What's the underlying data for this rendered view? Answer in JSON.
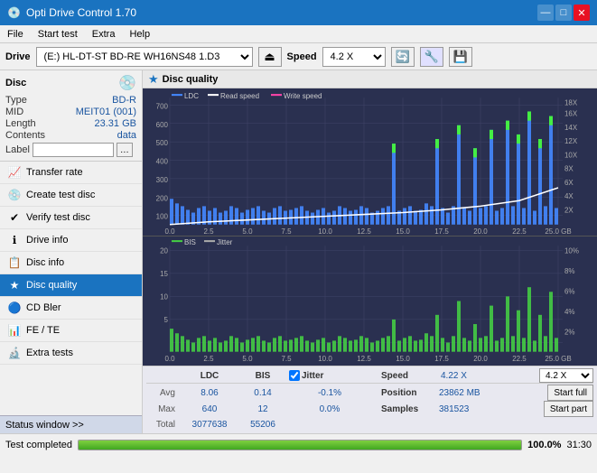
{
  "titleBar": {
    "title": "Opti Drive Control 1.70",
    "minBtn": "—",
    "maxBtn": "□",
    "closeBtn": "✕"
  },
  "menuBar": {
    "items": [
      "File",
      "Start test",
      "Extra",
      "Help"
    ]
  },
  "driveToolbar": {
    "driveLabel": "Drive",
    "driveValue": "(E:)  HL-DT-ST BD-RE  WH16NS48 1.D3",
    "speedLabel": "Speed",
    "speedValue": "4.2 X"
  },
  "sidebar": {
    "discSection": {
      "title": "Disc",
      "fields": [
        {
          "key": "Type",
          "value": "BD-R",
          "colored": true
        },
        {
          "key": "MID",
          "value": "MEIT01 (001)",
          "colored": true
        },
        {
          "key": "Length",
          "value": "23.31 GB",
          "colored": true
        },
        {
          "key": "Contents",
          "value": "data",
          "colored": true
        },
        {
          "key": "Label",
          "value": "",
          "isInput": true
        }
      ]
    },
    "navItems": [
      {
        "id": "transfer-rate",
        "label": "Transfer rate",
        "icon": "📈"
      },
      {
        "id": "create-test-disc",
        "label": "Create test disc",
        "icon": "💿"
      },
      {
        "id": "verify-test-disc",
        "label": "Verify test disc",
        "icon": "✔"
      },
      {
        "id": "drive-info",
        "label": "Drive info",
        "icon": "ℹ"
      },
      {
        "id": "disc-info",
        "label": "Disc info",
        "icon": "📋"
      },
      {
        "id": "disc-quality",
        "label": "Disc quality",
        "icon": "★",
        "active": true
      },
      {
        "id": "cd-bler",
        "label": "CD Bler",
        "icon": "🔵"
      },
      {
        "id": "fe-te",
        "label": "FE / TE",
        "icon": "📊"
      },
      {
        "id": "extra-tests",
        "label": "Extra tests",
        "icon": "🔬"
      }
    ],
    "statusWindow": "Status window >>"
  },
  "discQuality": {
    "title": "Disc quality",
    "chartTopLegend": {
      "ldc": "LDC",
      "readSpeed": "Read speed",
      "writeSpeed": "Write speed"
    },
    "chartTopYLeft": [
      "700",
      "600",
      "500",
      "400",
      "300",
      "200",
      "100"
    ],
    "chartTopYRight": [
      "18X",
      "16X",
      "14X",
      "12X",
      "10X",
      "8X",
      "6X",
      "4X",
      "2X"
    ],
    "chartBottomLegend": {
      "bis": "BIS",
      "jitter": "Jitter"
    },
    "chartBottomYLeft": [
      "20",
      "15",
      "10",
      "5"
    ],
    "chartBottomYRight": [
      "10%",
      "8%",
      "6%",
      "4%",
      "2%"
    ],
    "xAxisLabels": [
      "0.0",
      "2.5",
      "5.0",
      "7.5",
      "10.0",
      "12.5",
      "15.0",
      "17.5",
      "20.0",
      "22.5",
      "25.0 GB"
    ]
  },
  "stats": {
    "headers": {
      "ldc": "LDC",
      "bis": "BIS",
      "jitter": "Jitter",
      "speed": "Speed",
      "position": "Position",
      "samples": "Samples"
    },
    "rows": {
      "avg": {
        "label": "Avg",
        "ldc": "8.06",
        "bis": "0.14",
        "jitter": "-0.1%"
      },
      "max": {
        "label": "Max",
        "ldc": "640",
        "bis": "12",
        "jitter": "0.0%"
      },
      "total": {
        "label": "Total",
        "ldc": "3077638",
        "bis": "55206",
        "jitter": ""
      }
    },
    "speed": {
      "value": "4.22 X"
    },
    "position": {
      "value": "23862 MB"
    },
    "samples": {
      "value": "381523"
    },
    "speedDropdown": "4.2 X",
    "startFull": "Start full",
    "startPart": "Start part"
  },
  "bottomBar": {
    "statusText": "Test completed",
    "progressPct": "100.0%",
    "timeText": "31:30"
  },
  "colors": {
    "accent": "#1a73c0",
    "chartBg": "#2a3050",
    "gridLine": "#404468",
    "ldc": "#4488ff",
    "bis": "#44cc44",
    "readSpeed": "#ffffff",
    "writeSpeed": "#ff44aa"
  }
}
